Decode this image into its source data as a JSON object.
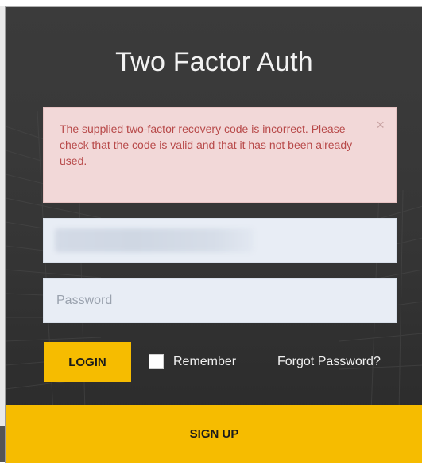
{
  "page": {
    "title": "Two Factor Auth"
  },
  "alert": {
    "message": "The supplied two-factor recovery code is incorrect. Please check that the code is valid and that it has not been already used.",
    "close_symbol": "×"
  },
  "form": {
    "username_value": "",
    "password_placeholder": "Password",
    "login_label": "LOGIN",
    "remember_label": "Remember",
    "forgot_label": "Forgot Password?",
    "signup_label": "SIGN UP"
  },
  "icons": {
    "close": "close-icon"
  },
  "colors": {
    "accent": "#f6bc00",
    "alert_bg": "#f2d8d8",
    "alert_text": "#b84a4a",
    "input_bg": "#e8edf5",
    "background": "#363636"
  }
}
